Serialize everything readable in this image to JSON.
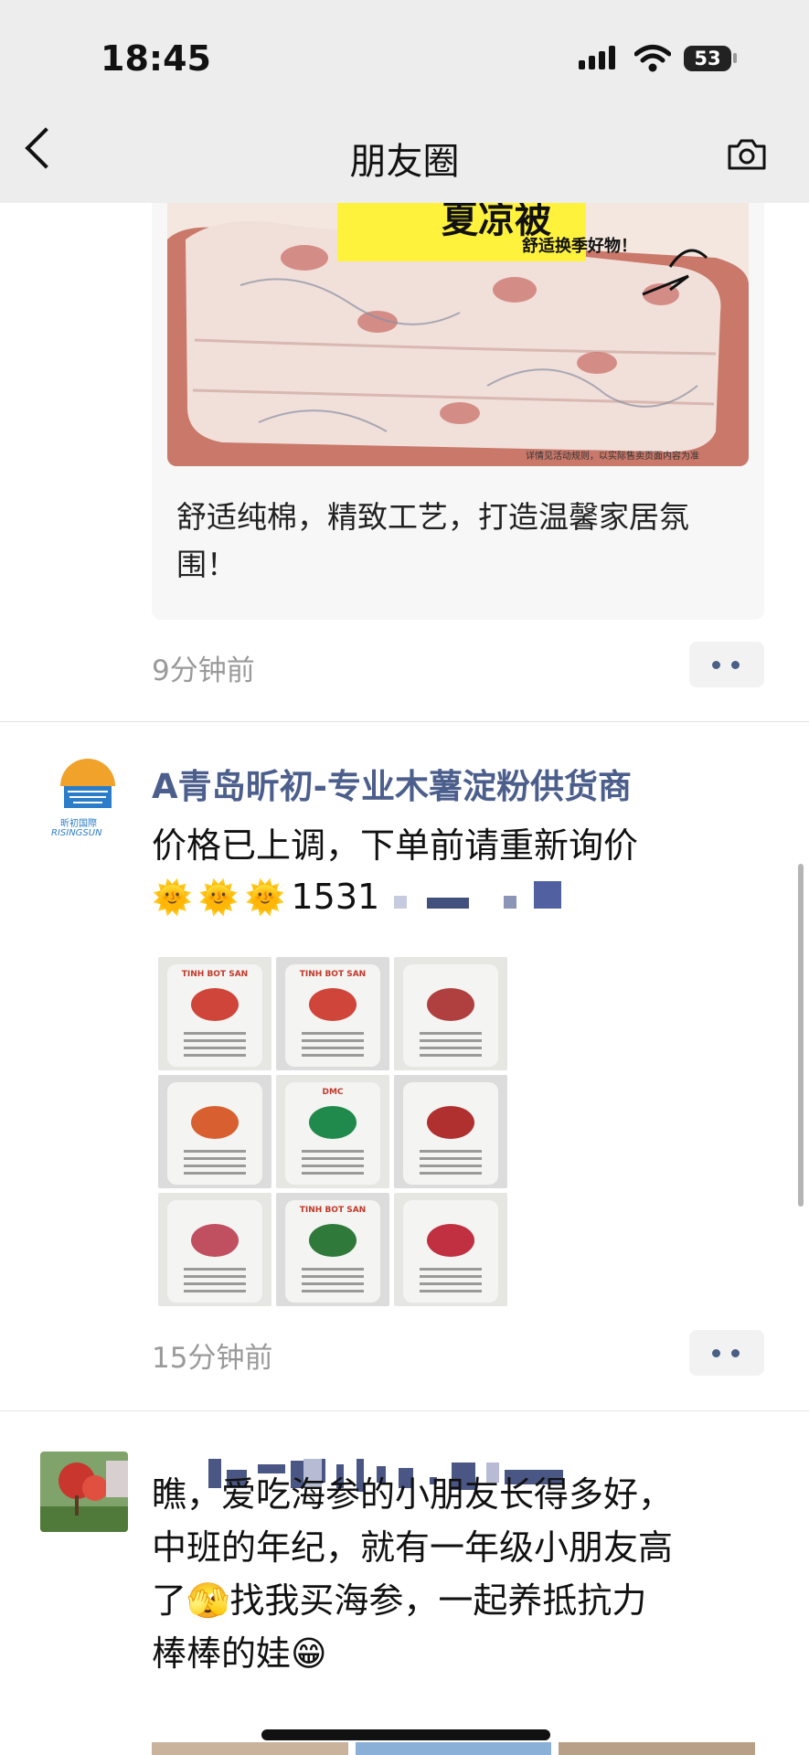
{
  "status_bar": {
    "time": "18:45",
    "battery": "53"
  },
  "nav": {
    "title": "朋友圈"
  },
  "posts": [
    {
      "ad_banner": {
        "title": "夏凉被",
        "subtitle": "舒适换季好物！",
        "disclaimer": "详情见活动规则，以实际售卖页面内容为准"
      },
      "caption": "舒适纯棉，精致工艺，打造温馨家居氛围！",
      "time": "9分钟前"
    },
    {
      "author": "A青岛昕初-专业木薯淀粉供货商",
      "avatar_text": "昕初国際",
      "avatar_subtext": "RISINGSUN",
      "text_line1": "价格已上调，下单前请重新询价",
      "emoji_line": "🌞🌞🌞",
      "phone_partial": "1531",
      "images": [
        {
          "label": "TINH BOT SAN",
          "mark": "#d0453a"
        },
        {
          "label": "TINH BOT SAN",
          "mark": "#d0453a"
        },
        {
          "label": "",
          "mark": "#b04040"
        },
        {
          "label": "",
          "mark": "#d86030"
        },
        {
          "label": "DMC",
          "mark": "#1f8a4c"
        },
        {
          "label": "",
          "mark": "#b03030"
        },
        {
          "label": "",
          "mark": "#c05060"
        },
        {
          "label": "TINH BOT SAN",
          "mark": "#2f7a3a"
        },
        {
          "label": "",
          "mark": "#c03040"
        }
      ],
      "time": "15分钟前"
    },
    {
      "text_line1": "瞧，爱吃海参的小朋友长得多好，",
      "text_line2": "中班的年纪，就有一年级小朋友高",
      "text_line3": "了🫣找我买海参，一起养抵抗力",
      "text_line4": "棒棒的娃😁"
    }
  ],
  "colors": {
    "name_link": "#4c5f8c",
    "timestamp": "#9a9a9a",
    "banner_yellow": "#fff23d"
  }
}
